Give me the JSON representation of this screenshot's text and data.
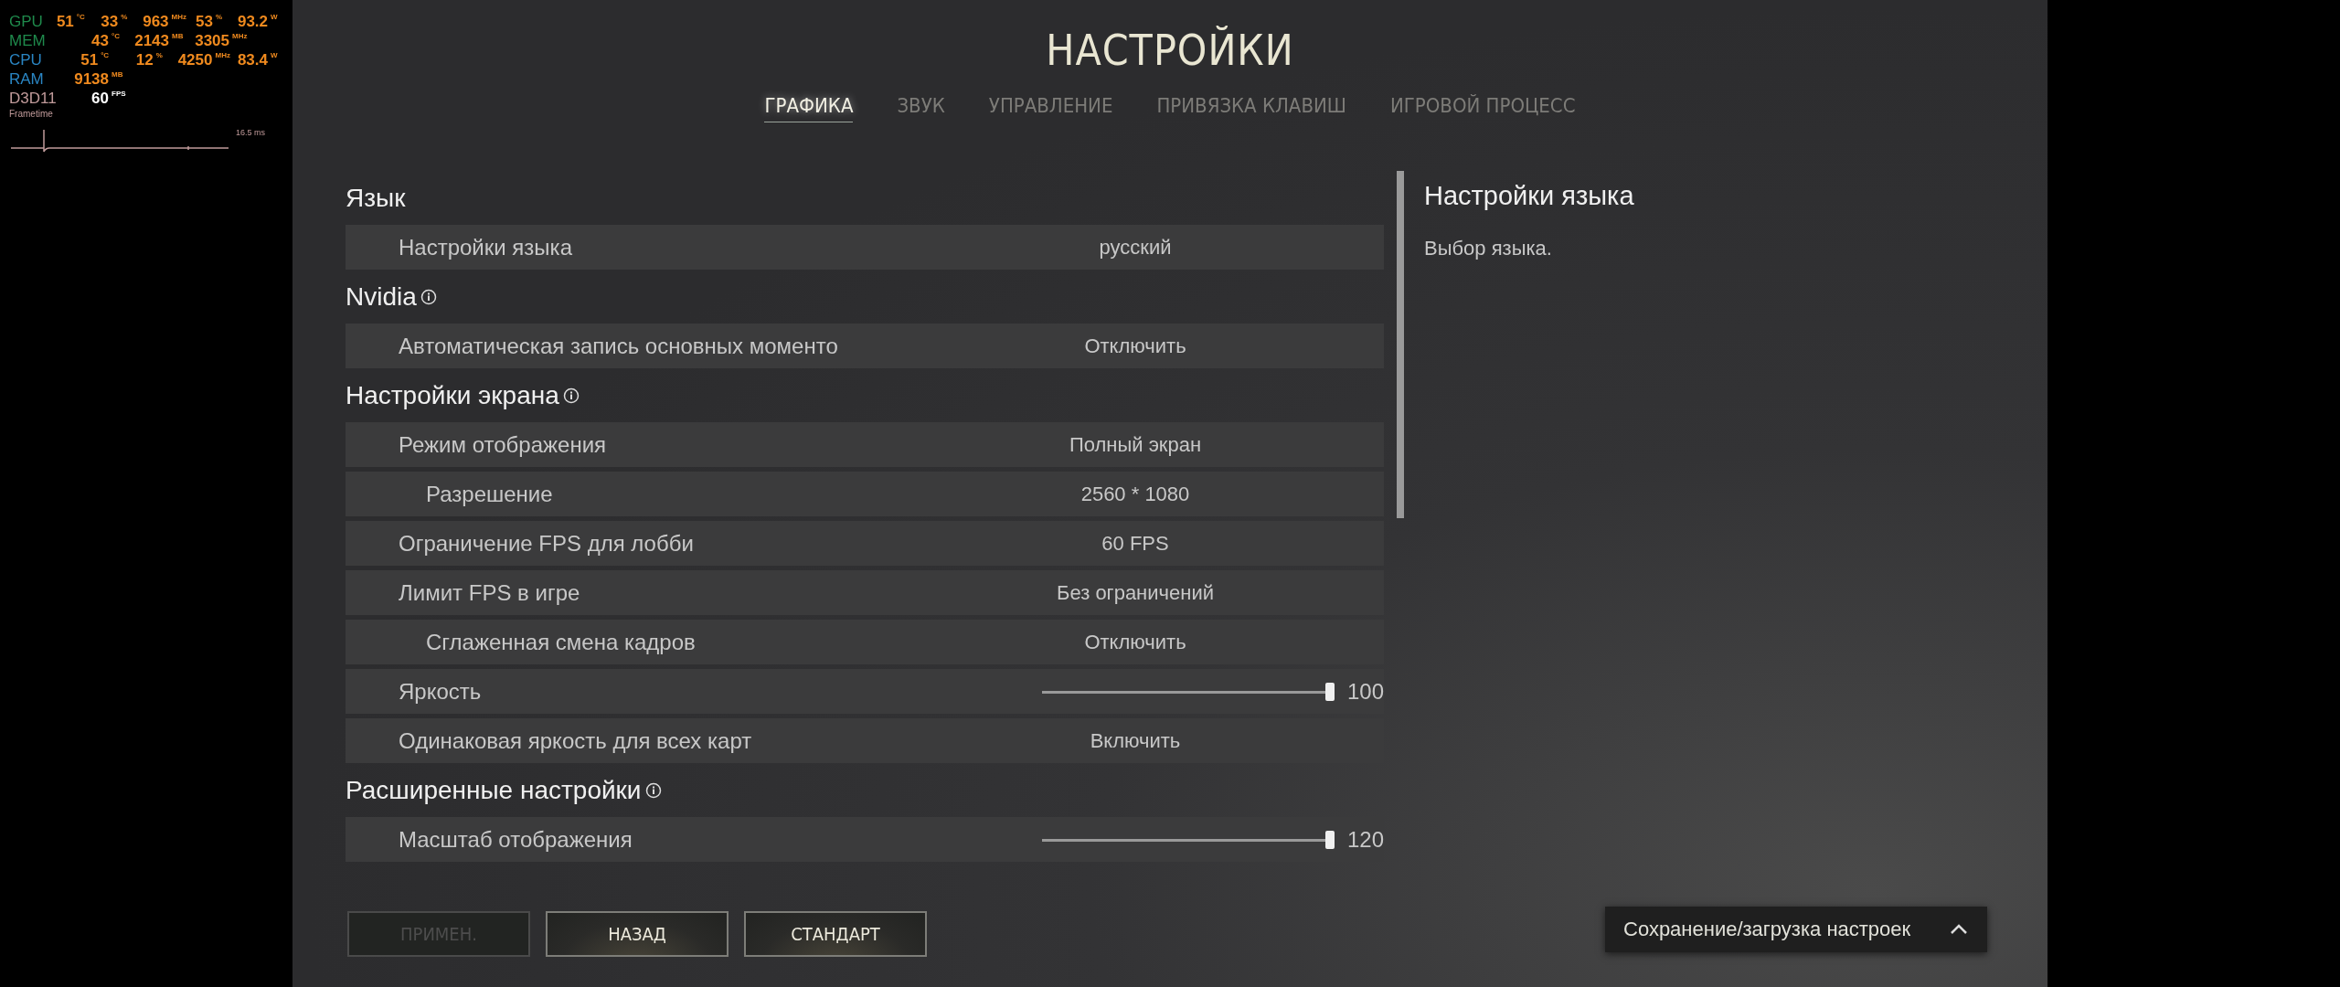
{
  "overlay": {
    "rows": [
      {
        "label": "GPU",
        "color": "#1f8a4c",
        "values": [
          {
            "value": "51",
            "unit": "°C"
          },
          {
            "value": "33",
            "unit": "%"
          },
          {
            "value": "963",
            "unit": "MHz"
          },
          {
            "value": "53",
            "unit": "%"
          },
          {
            "value": "93.2",
            "unit": "W"
          }
        ]
      },
      {
        "label": "MEM",
        "color": "#1f8a4c",
        "values": [
          {
            "value": "43",
            "unit": "°C"
          },
          {
            "value": "2143",
            "unit": "MB"
          },
          {
            "value": "3305",
            "unit": "MHz"
          }
        ]
      },
      {
        "label": "CPU",
        "color": "#2a86c4",
        "values": [
          {
            "value": "51",
            "unit": "°C"
          },
          {
            "value": "12",
            "unit": "%"
          },
          {
            "value": "4250",
            "unit": "MHz"
          },
          {
            "value": "83.4",
            "unit": "W"
          }
        ]
      },
      {
        "label": "RAM",
        "color": "#2a86c4",
        "values": [
          {
            "value": "9138",
            "unit": "MB"
          }
        ]
      },
      {
        "label": "D3D11",
        "color": "#c09a9a",
        "values": [
          {
            "value": "60",
            "unit": "FPS"
          }
        ]
      }
    ],
    "frametime_label": "Frametime",
    "frametime_reading": "16.5 ms"
  },
  "title": "НАСТРОЙКИ",
  "tabs": [
    {
      "label": "ГРАФИКА",
      "selected": true
    },
    {
      "label": "ЗВУК",
      "selected": false
    },
    {
      "label": "УПРАВЛЕНИЕ",
      "selected": false
    },
    {
      "label": "ПРИВЯЗКА КЛАВИШ",
      "selected": false
    },
    {
      "label": "ИГРОВОЙ ПРОЦЕСС",
      "selected": false
    }
  ],
  "sections": [
    {
      "heading": "Язык",
      "info_icon": false,
      "settings": [
        {
          "kind": "select",
          "label": "Настройки языка",
          "value": "русский"
        }
      ]
    },
    {
      "heading": "Nvidia",
      "info_icon": true,
      "settings": [
        {
          "kind": "select",
          "label": "Автоматическая запись основных моменто",
          "value": "Отключить"
        }
      ]
    },
    {
      "heading": "Настройки экрана",
      "info_icon": true,
      "settings": [
        {
          "kind": "select",
          "label": "Режим отображения",
          "value": "Полный экран",
          "children": [
            {
              "kind": "select",
              "label": "Разрешение",
              "value": "2560 * 1080"
            }
          ]
        },
        {
          "kind": "select",
          "label": "Ограничение FPS для лобби",
          "value": "60 FPS"
        },
        {
          "kind": "select",
          "label": "Лимит FPS в игре",
          "value": "Без ограничений",
          "children": [
            {
              "kind": "select",
              "label": "Сглаженная смена кадров",
              "value": "Отключить"
            }
          ]
        },
        {
          "kind": "slider",
          "label": "Яркость",
          "level": 1.0,
          "value": "100"
        },
        {
          "kind": "select",
          "label": "Одинаковая яркость для всех карт",
          "value": "Включить"
        }
      ]
    },
    {
      "heading": "Расширенные настройки",
      "info_icon": true,
      "settings": [
        {
          "kind": "slider",
          "label": "Масштаб отображения",
          "level": 1.0,
          "value": "120"
        }
      ]
    }
  ],
  "description": {
    "title": "Настройки языка",
    "text": "Выбор языка."
  },
  "buttons": [
    {
      "label": "ПРИМЕН.",
      "disabled": true
    },
    {
      "label": "НАЗАД",
      "disabled": false
    },
    {
      "label": "СТАНДАРТ",
      "disabled": false
    }
  ],
  "presets": {
    "label": "Сохранение/загрузка настроек",
    "expanded": false
  }
}
